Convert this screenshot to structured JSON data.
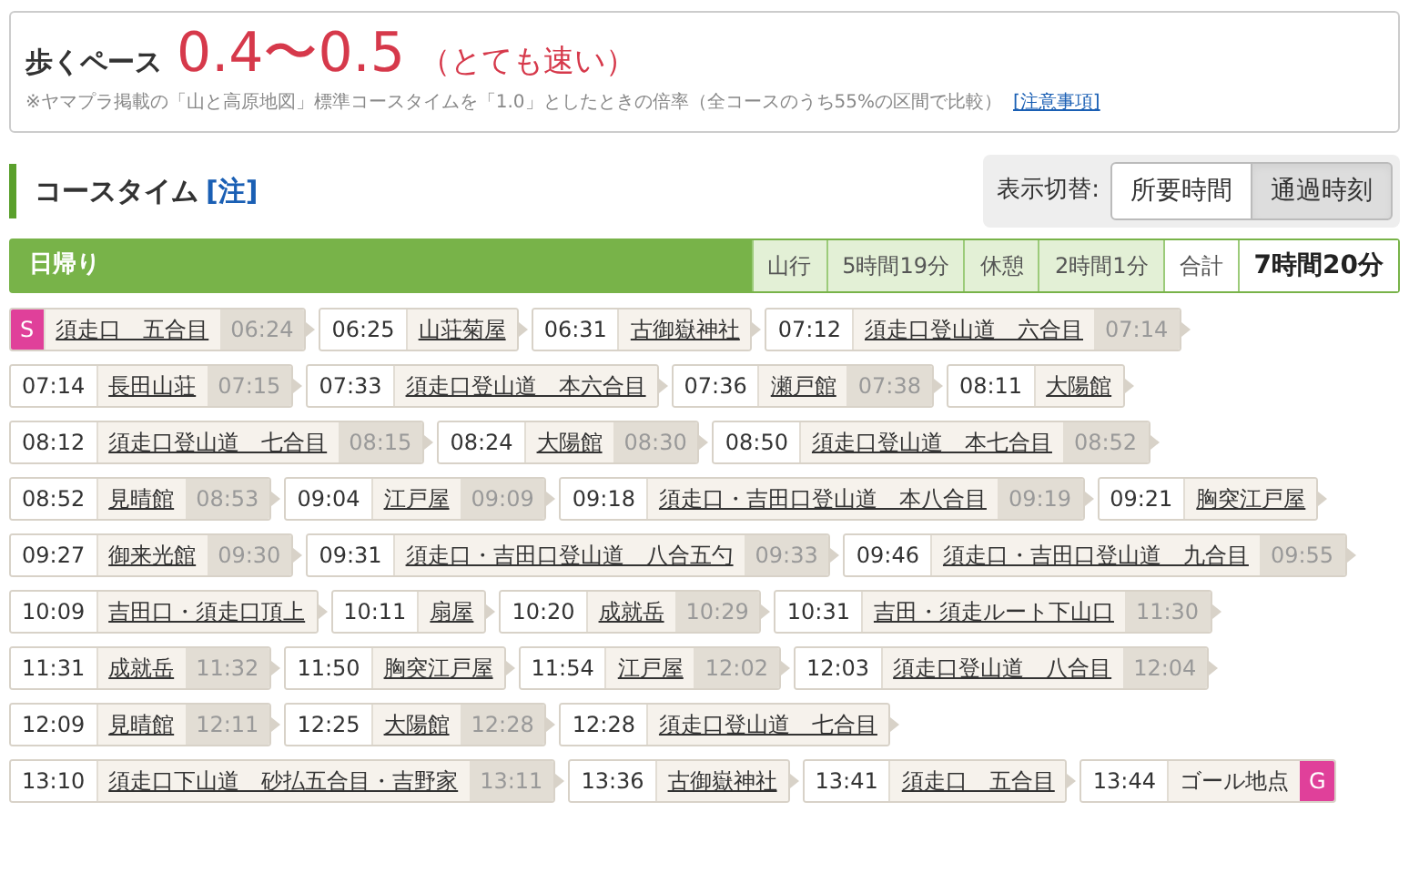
{
  "pace": {
    "label": "歩くペース",
    "value": "0.4〜0.5",
    "rating": "（とても速い）",
    "note": "※ヤマプラ掲載の「山と高原地図」標準コースタイムを「1.0」としたときの倍率（全コースのうち55%の区間で比較）",
    "note_link": "[注意事項]"
  },
  "section": {
    "title": "コースタイム",
    "note_link": "[注]"
  },
  "display_toggle": {
    "label": "表示切替:",
    "options": [
      {
        "label": "所要時間",
        "selected": false
      },
      {
        "label": "通過時刻",
        "selected": true
      }
    ]
  },
  "summary": {
    "title": "日帰り",
    "items": [
      {
        "label": "山行",
        "value": "5時間19分",
        "kind": "part"
      },
      {
        "label": "休憩",
        "value": "2時間1分",
        "kind": "part"
      },
      {
        "label": "合計",
        "value": "7時間20分",
        "kind": "total"
      }
    ]
  },
  "stops": [
    {
      "start_badge": "S",
      "name": "須走口　五合目",
      "link": true,
      "depart": "06:24"
    },
    {
      "arrive": "06:25",
      "name": "山荘菊屋",
      "link": true
    },
    {
      "arrive": "06:31",
      "name": "古御嶽神社",
      "link": true
    },
    {
      "arrive": "07:12",
      "name": "須走口登山道　六合目",
      "link": true,
      "depart": "07:14"
    },
    {
      "arrive": "07:14",
      "name": "長田山荘",
      "link": true,
      "depart": "07:15"
    },
    {
      "arrive": "07:33",
      "name": "須走口登山道　本六合目",
      "link": true
    },
    {
      "arrive": "07:36",
      "name": "瀬戸館",
      "link": true,
      "depart": "07:38"
    },
    {
      "arrive": "08:11",
      "name": "大陽館",
      "link": true
    },
    {
      "arrive": "08:12",
      "name": "須走口登山道　七合目",
      "link": true,
      "depart": "08:15"
    },
    {
      "arrive": "08:24",
      "name": "大陽館",
      "link": true,
      "depart": "08:30"
    },
    {
      "arrive": "08:50",
      "name": "須走口登山道　本七合目",
      "link": true,
      "depart": "08:52"
    },
    {
      "arrive": "08:52",
      "name": "見晴館",
      "link": true,
      "depart": "08:53"
    },
    {
      "arrive": "09:04",
      "name": "江戸屋",
      "link": true,
      "depart": "09:09"
    },
    {
      "arrive": "09:18",
      "name": "須走口・吉田口登山道　本八合目",
      "link": true,
      "depart": "09:19"
    },
    {
      "arrive": "09:21",
      "name": "胸突江戸屋",
      "link": true
    },
    {
      "arrive": "09:27",
      "name": "御来光館",
      "link": true,
      "depart": "09:30"
    },
    {
      "arrive": "09:31",
      "name": "須走口・吉田口登山道　八合五勺",
      "link": true,
      "depart": "09:33"
    },
    {
      "arrive": "09:46",
      "name": "須走口・吉田口登山道　九合目",
      "link": true,
      "depart": "09:55"
    },
    {
      "arrive": "10:09",
      "name": "吉田口・須走口頂上",
      "link": true
    },
    {
      "arrive": "10:11",
      "name": "扇屋",
      "link": true
    },
    {
      "arrive": "10:20",
      "name": "成就岳",
      "link": true,
      "depart": "10:29"
    },
    {
      "arrive": "10:31",
      "name": "吉田・須走ルート下山口",
      "link": true,
      "depart": "11:30"
    },
    {
      "arrive": "11:31",
      "name": "成就岳",
      "link": true,
      "depart": "11:32"
    },
    {
      "arrive": "11:50",
      "name": "胸突江戸屋",
      "link": true
    },
    {
      "arrive": "11:54",
      "name": "江戸屋",
      "link": true,
      "depart": "12:02"
    },
    {
      "arrive": "12:03",
      "name": "須走口登山道　八合目",
      "link": true,
      "depart": "12:04"
    },
    {
      "arrive": "12:09",
      "name": "見晴館",
      "link": true,
      "depart": "12:11"
    },
    {
      "arrive": "12:25",
      "name": "大陽館",
      "link": true,
      "depart": "12:28"
    },
    {
      "arrive": "12:28",
      "name": "須走口登山道　七合目",
      "link": true
    },
    {
      "arrive": "13:10",
      "name": "須走口下山道　砂払五合目・吉野家",
      "link": true,
      "depart": "13:11"
    },
    {
      "arrive": "13:36",
      "name": "古御嶽神社",
      "link": true
    },
    {
      "arrive": "13:41",
      "name": "須走口　五合目",
      "link": true
    },
    {
      "arrive": "13:44",
      "name": "ゴール地点",
      "link": false,
      "goal_badge": "G"
    }
  ]
}
